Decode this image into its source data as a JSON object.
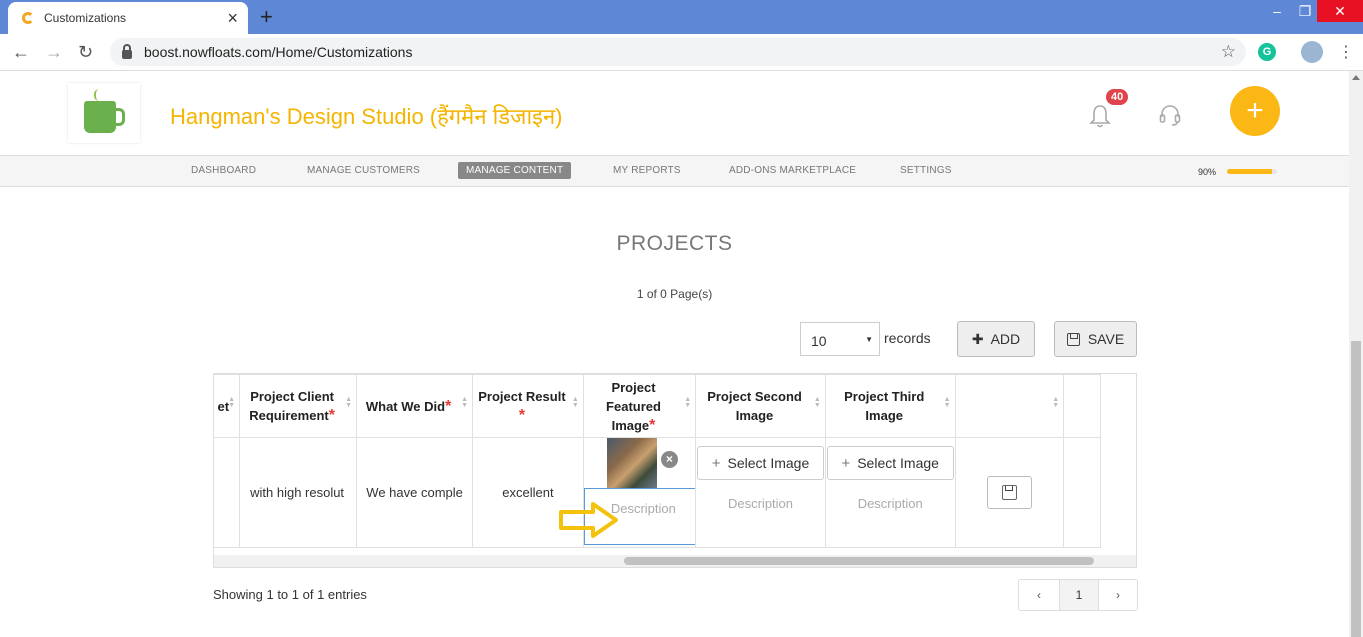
{
  "browser": {
    "tab_title": "Customizations",
    "url": "boost.nowfloats.com/Home/Customizations",
    "grammarly_letter": "G"
  },
  "header": {
    "site_title": "Hangman's Design Studio (हैंगमैन डिजाइन)",
    "notification_count": "40",
    "fab_symbol": "+"
  },
  "menu": {
    "items": [
      {
        "label": "DASHBOARD"
      },
      {
        "label": "MANAGE CUSTOMERS"
      },
      {
        "label": "MANAGE CONTENT"
      },
      {
        "label": "MY REPORTS"
      },
      {
        "label": "ADD-ONS MARKETPLACE"
      },
      {
        "label": "SETTINGS"
      }
    ],
    "active_index": 2,
    "progress_label": "90%",
    "progress_value": 0.9
  },
  "content": {
    "title": "PROJECTS",
    "page_info": "1 of 0 Page(s)",
    "records_value": "10",
    "records_label": "records",
    "add_label": "ADD",
    "save_label": "SAVE"
  },
  "table": {
    "headers": [
      {
        "label": "et",
        "required": false
      },
      {
        "label": "Project Client Requirement",
        "required": true
      },
      {
        "label": "What We Did",
        "required": true
      },
      {
        "label": "Project Result",
        "required": true
      },
      {
        "label": "Project Featured Image",
        "required": true
      },
      {
        "label": "Project Second Image",
        "required": false
      },
      {
        "label": "Project Third Image",
        "required": false
      },
      {
        "label": "",
        "required": false
      }
    ],
    "row": {
      "client_requirement": "with high resolut",
      "what_we_did": "We have comple",
      "result": "excellent",
      "featured_description_placeholder": "Description",
      "select_image_label": "Select Image",
      "description_placeholder": "Description"
    }
  },
  "footer": {
    "entries_text": "Showing 1 to 1 of 1 entries",
    "prev": "‹",
    "current_page": "1",
    "next": "›"
  },
  "colors": {
    "brand": "#f4b400",
    "fab": "#fbb714",
    "badge": "#e0434b",
    "required": "#e53935"
  }
}
